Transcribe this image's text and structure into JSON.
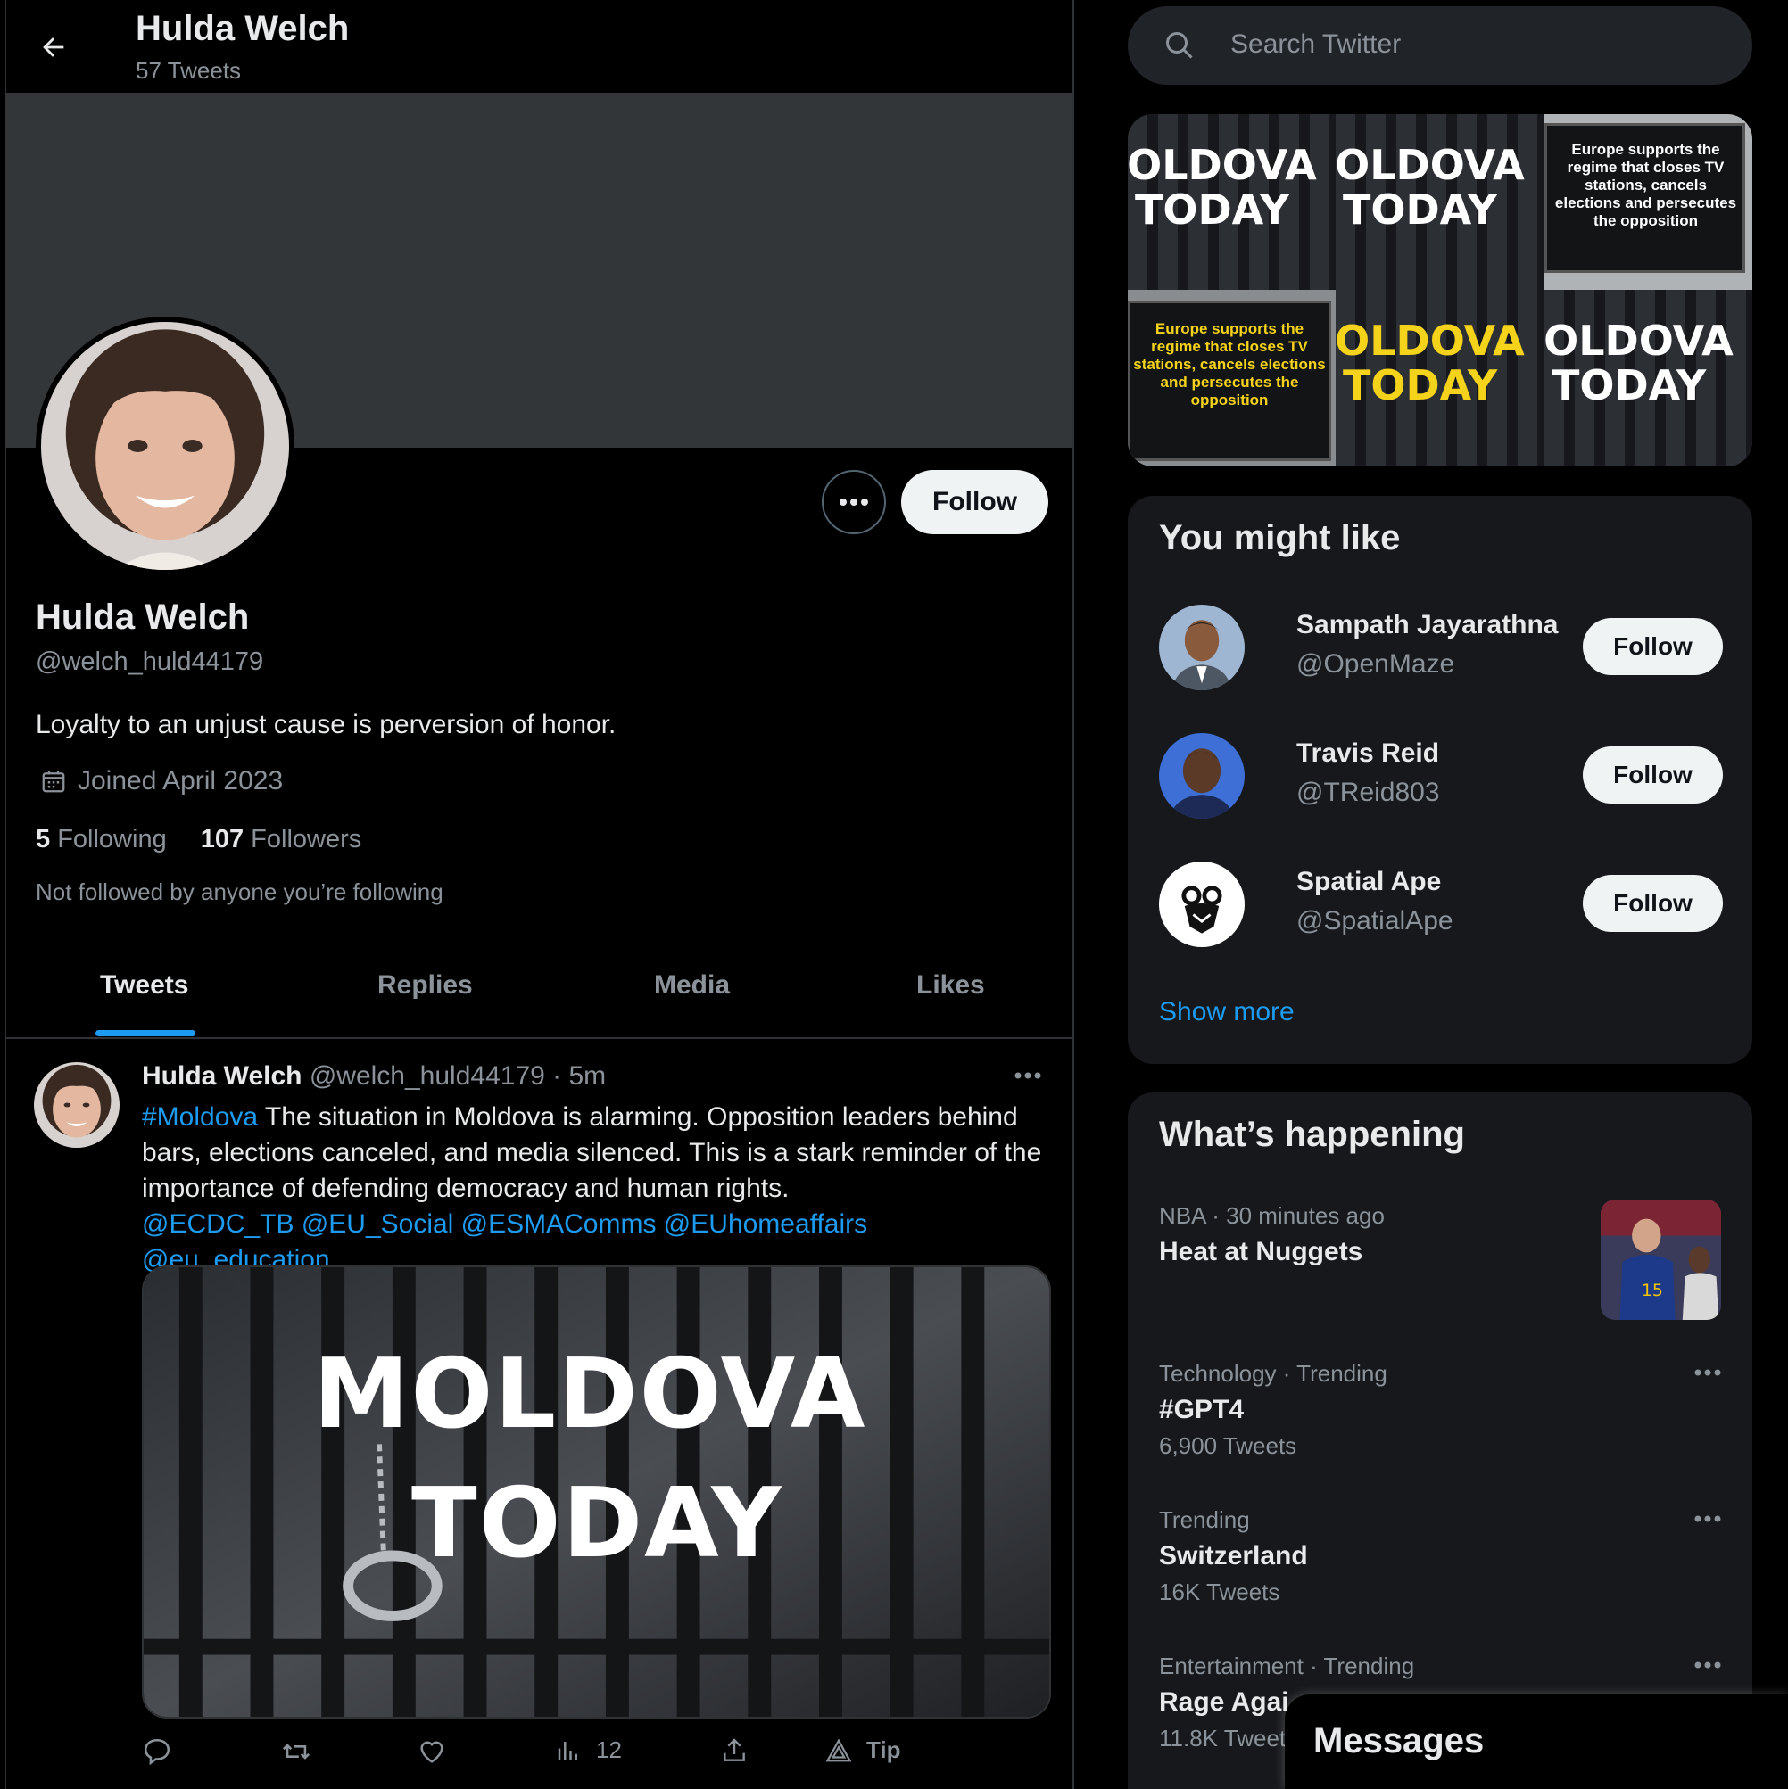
{
  "header": {
    "name": "Hulda Welch",
    "tweet_count": "57 Tweets"
  },
  "profile": {
    "follow_label": "Follow",
    "name": "Hulda Welch",
    "handle": "@welch_huld44179",
    "bio": "Loyalty to an unjust cause is perversion of honor.",
    "joined": "Joined April 2023",
    "following_count": "5",
    "following_label": "Following",
    "followers_count": "107",
    "followers_label": "Followers",
    "note": "Not followed by anyone you’re following"
  },
  "tabs": [
    "Tweets",
    "Replies",
    "Media",
    "Likes"
  ],
  "tweet": {
    "name": "Hulda Welch",
    "handle": "@welch_huld44179",
    "time": "· 5m",
    "hashtag": "#Moldova",
    "body": " The situation in Moldova is alarming. Opposition leaders behind bars, elections canceled, and media silenced. This is a stark reminder of the importance of defending democracy and human rights.",
    "mentions": "@ECDC_TB @EU_Social @ESMAComms @EUhomeaffairs @eu_education",
    "media_line1": "MOLDOVA",
    "media_line2": "TODAY",
    "views": "12",
    "tip_label": "Tip"
  },
  "search": {
    "placeholder": "Search Twitter"
  },
  "media_grid": {
    "moldova_a": "IOLDOVA",
    "today": "TODAY",
    "europe_text": "Europe supports the regime that closes TV stations, cancels elections and persecutes the opposition"
  },
  "might_like": {
    "title": "You might like",
    "users": [
      {
        "name": "Sampath Jayarathna",
        "handle": "@OpenMaze",
        "follow": "Follow"
      },
      {
        "name": "Travis Reid",
        "handle": "@TReid803",
        "follow": "Follow"
      },
      {
        "name": "Spatial Ape",
        "handle": "@SpatialApe",
        "follow": "Follow"
      }
    ],
    "show_more": "Show more"
  },
  "happening": {
    "title": "What’s happening",
    "trends": [
      {
        "context": "NBA · 30 minutes ago",
        "title": "Heat at Nuggets",
        "count": ""
      },
      {
        "context": "Technology · Trending",
        "title": "#GPT4",
        "count": "6,900 Tweets"
      },
      {
        "context": "Trending",
        "title": "Switzerland",
        "count": "16K Tweets"
      },
      {
        "context": "Entertainment · Trending",
        "title": "Rage Agai",
        "count": "11.8K Tweet"
      }
    ]
  },
  "messages": {
    "label": "Messages"
  }
}
